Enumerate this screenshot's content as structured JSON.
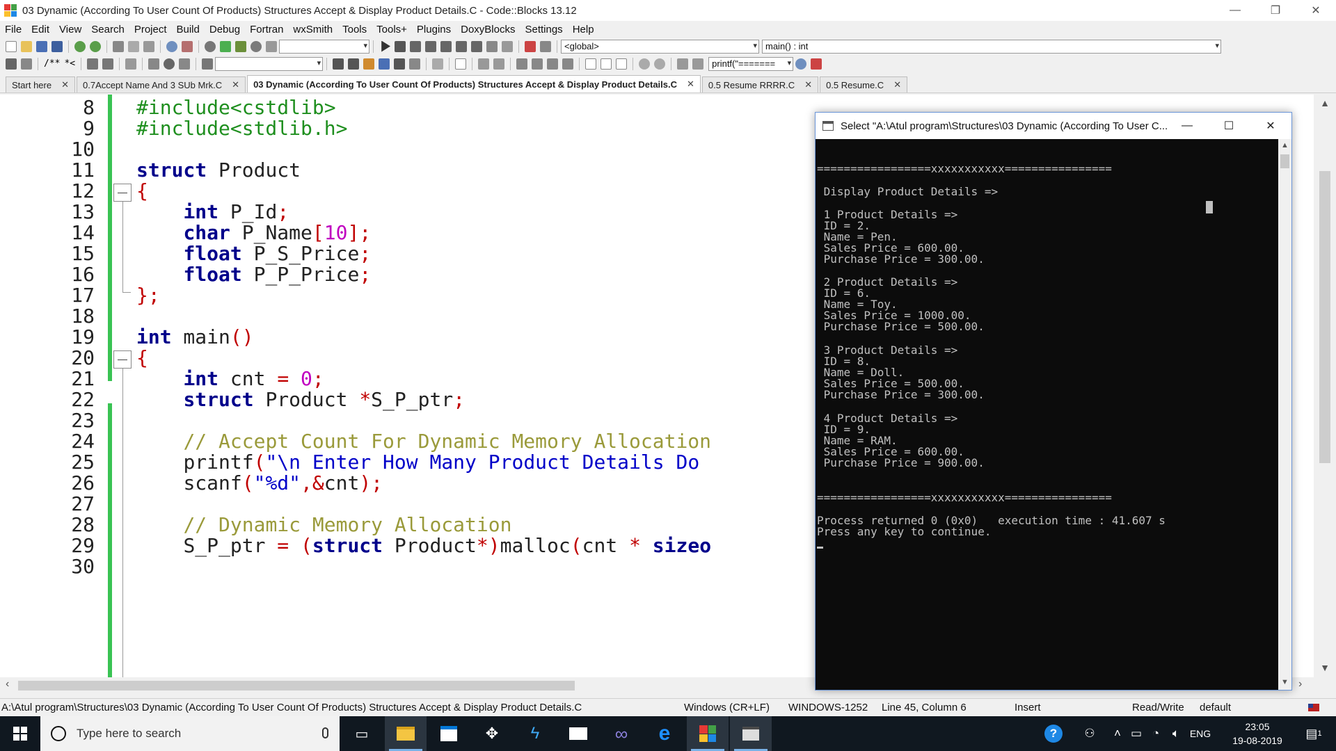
{
  "window": {
    "title": "03 Dynamic (According To User Count Of Products) Structures Accept & Display Product Details.C - Code::Blocks 13.12",
    "minimize": "—",
    "maximize": "❐",
    "close": "✕"
  },
  "menu": [
    "File",
    "Edit",
    "View",
    "Search",
    "Project",
    "Build",
    "Debug",
    "Fortran",
    "wxSmith",
    "Tools",
    "Tools+",
    "Plugins",
    "DoxyBlocks",
    "Settings",
    "Help"
  ],
  "toolbar": {
    "scope_combo": "<global>",
    "function_combo": "main() : int",
    "search_combo": "printf(\"=======",
    "comment_label": "/**",
    "comment_label2": "*<"
  },
  "tabs": [
    {
      "label": "Start here",
      "close": "✕"
    },
    {
      "label": "0.7Accept Name And 3 SUb Mrk.C",
      "close": "✕"
    },
    {
      "label": "03 Dynamic (According To User Count Of Products) Structures Accept & Display Product Details.C",
      "close": "✕",
      "active": true
    },
    {
      "label": "0.5 Resume RRRR.C",
      "close": "✕"
    },
    {
      "label": "0.5 Resume.C",
      "close": "✕"
    }
  ],
  "editor": {
    "line_numbers": [
      "8",
      "9",
      "10",
      "11",
      "12",
      "13",
      "14",
      "15",
      "16",
      "17",
      "18",
      "19",
      "20",
      "21",
      "22",
      "23",
      "24",
      "25",
      "26",
      "27",
      "28",
      "29",
      "30"
    ],
    "lines": {
      "l8": {
        "a": "#include<cstdlib>"
      },
      "l9": {
        "a": "#include<stdlib.h>"
      },
      "l11": {
        "a": "struct",
        "b": " Product"
      },
      "l12": {
        "a": "{"
      },
      "l13": {
        "ind": "    ",
        "a": "int",
        "b": " P_Id",
        "c": ";"
      },
      "l14": {
        "ind": "    ",
        "a": "char",
        "b": " P_Name",
        "c": "[",
        "d": "10",
        "e": "];"
      },
      "l15": {
        "ind": "    ",
        "a": "float",
        "b": " P_S_Price",
        "c": ";"
      },
      "l16": {
        "ind": "    ",
        "a": "float",
        "b": " P_P_Price",
        "c": ";"
      },
      "l17": {
        "a": "};"
      },
      "l19": {
        "a": "int",
        "b": " main",
        "c": "()"
      },
      "l20": {
        "a": "{"
      },
      "l21": {
        "ind": "    ",
        "a": "int",
        "b": " cnt ",
        "c": "=",
        "d": " ",
        "e": "0",
        "f": ";"
      },
      "l22": {
        "ind": "    ",
        "a": "struct",
        "b": " Product ",
        "c": "*",
        "d": "S_P_ptr",
        "e": ";"
      },
      "l24": {
        "ind": "    ",
        "a": "// Accept Count For Dynamic Memory Allocation"
      },
      "l25": {
        "ind": "    ",
        "a": "printf",
        "b": "(",
        "c": "\"\\n Enter How Many Product Details Do"
      },
      "l26": {
        "ind": "    ",
        "a": "scanf",
        "b": "(",
        "c": "\"%d\"",
        "d": ",&",
        "e": "cnt",
        "f": ");"
      },
      "l28": {
        "ind": "    ",
        "a": "// Dynamic Memory Allocation"
      },
      "l29": {
        "ind": "    ",
        "a": "S_P_ptr ",
        "b": "=",
        "c": " ",
        "d": "(",
        "e": "struct",
        "f": " Product",
        "g": "*)",
        "h": "malloc",
        "i": "(",
        "j": "cnt ",
        "k": "*",
        "l": " ",
        "m": "sizeo"
      }
    }
  },
  "console": {
    "title": "Select \"A:\\Atul program\\Structures\\03 Dynamic (According To User C...",
    "lines": [
      "=================xxxxxxxxxxx================",
      "",
      " Display Product Details =>",
      "",
      " 1 Product Details =>",
      " ID = 2.",
      " Name = Pen.",
      " Sales Price = 600.00.",
      " Purchase Price = 300.00.",
      "",
      " 2 Product Details =>",
      " ID = 6.",
      " Name = Toy.",
      " Sales Price = 1000.00.",
      " Purchase Price = 500.00.",
      "",
      " 3 Product Details =>",
      " ID = 8.",
      " Name = Doll.",
      " Sales Price = 500.00.",
      " Purchase Price = 300.00.",
      "",
      " 4 Product Details =>",
      " ID = 9.",
      " Name = RAM.",
      " Sales Price = 600.00.",
      " Purchase Price = 900.00.",
      "",
      "",
      "=================xxxxxxxxxxx================",
      "",
      "Process returned 0 (0x0)   execution time : 41.607 s",
      "Press any key to continue."
    ]
  },
  "status": {
    "path": "A:\\Atul program\\Structures\\03 Dynamic (According To User Count Of Products) Structures Accept & Display Product Details.C",
    "eol": "Windows (CR+LF)",
    "encoding": "WINDOWS-1252",
    "position": "Line 45, Column 6",
    "mode": "Insert",
    "access": "Read/Write",
    "profile": "default"
  },
  "taskbar": {
    "search_placeholder": "Type here to search",
    "language": "ENG",
    "time": "23:05",
    "date": "19-08-2019",
    "notifications": "1"
  },
  "colors": {
    "keyword": "#00008b",
    "preprocessor": "#1f8f1f",
    "operator": "#c00000",
    "number": "#c000c0",
    "string": "#0000c8",
    "comment": "#9a9a3a",
    "change_bar": "#39c353",
    "console_bg": "#0c0c0c",
    "console_fg": "#c0c0c0",
    "taskbar": "#101820"
  }
}
